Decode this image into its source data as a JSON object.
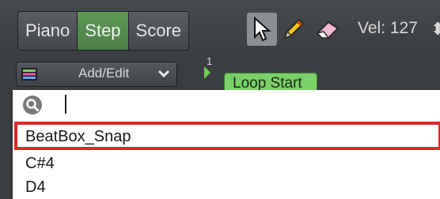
{
  "toolbar": {
    "view_tabs": [
      "Piano",
      "Step",
      "Score"
    ],
    "active_tab": "Step",
    "tools": [
      {
        "icon": "arrow-pointer-icon",
        "selected": true
      },
      {
        "icon": "pencil-icon",
        "selected": false
      },
      {
        "icon": "eraser-icon",
        "selected": false
      }
    ],
    "velocity_label": "Vel: 127"
  },
  "edit_mode": {
    "label": "Add/Edit",
    "icon": "lanes-icon"
  },
  "ruler": {
    "bar_number": "1",
    "loop_start_label": "Loop Start"
  },
  "dropdown": {
    "search_value": "",
    "items": [
      "BeatBox_Snap",
      "C#4",
      "D4"
    ],
    "highlighted_item": "BeatBox_Snap"
  },
  "colors": {
    "active_tab": "#4f8a48",
    "loop_tag": "#7bd06a",
    "highlight_box": "#e0262b"
  }
}
